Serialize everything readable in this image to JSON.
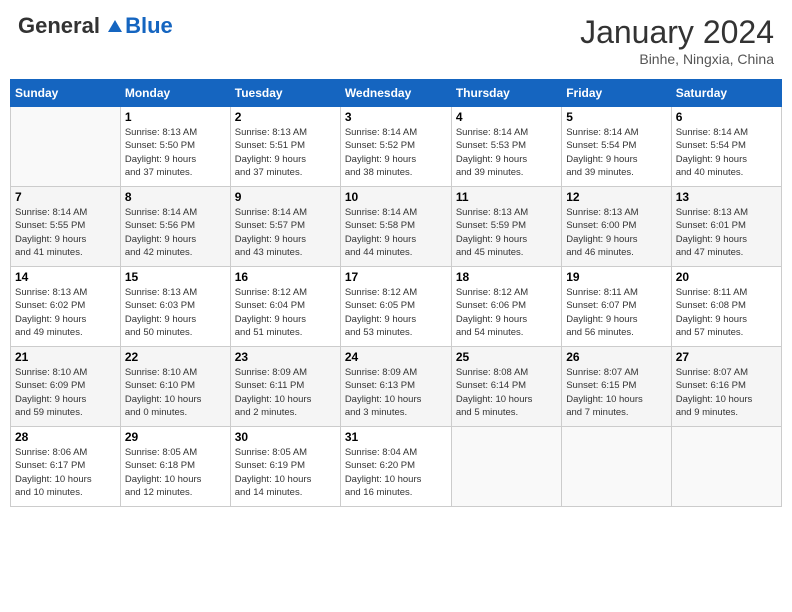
{
  "header": {
    "logo_general": "General",
    "logo_blue": "Blue",
    "month_title": "January 2024",
    "location": "Binhe, Ningxia, China"
  },
  "days_of_week": [
    "Sunday",
    "Monday",
    "Tuesday",
    "Wednesday",
    "Thursday",
    "Friday",
    "Saturday"
  ],
  "weeks": [
    [
      {
        "day": "",
        "info": ""
      },
      {
        "day": "1",
        "info": "Sunrise: 8:13 AM\nSunset: 5:50 PM\nDaylight: 9 hours\nand 37 minutes."
      },
      {
        "day": "2",
        "info": "Sunrise: 8:13 AM\nSunset: 5:51 PM\nDaylight: 9 hours\nand 37 minutes."
      },
      {
        "day": "3",
        "info": "Sunrise: 8:14 AM\nSunset: 5:52 PM\nDaylight: 9 hours\nand 38 minutes."
      },
      {
        "day": "4",
        "info": "Sunrise: 8:14 AM\nSunset: 5:53 PM\nDaylight: 9 hours\nand 39 minutes."
      },
      {
        "day": "5",
        "info": "Sunrise: 8:14 AM\nSunset: 5:54 PM\nDaylight: 9 hours\nand 39 minutes."
      },
      {
        "day": "6",
        "info": "Sunrise: 8:14 AM\nSunset: 5:54 PM\nDaylight: 9 hours\nand 40 minutes."
      }
    ],
    [
      {
        "day": "7",
        "info": "Sunrise: 8:14 AM\nSunset: 5:55 PM\nDaylight: 9 hours\nand 41 minutes."
      },
      {
        "day": "8",
        "info": "Sunrise: 8:14 AM\nSunset: 5:56 PM\nDaylight: 9 hours\nand 42 minutes."
      },
      {
        "day": "9",
        "info": "Sunrise: 8:14 AM\nSunset: 5:57 PM\nDaylight: 9 hours\nand 43 minutes."
      },
      {
        "day": "10",
        "info": "Sunrise: 8:14 AM\nSunset: 5:58 PM\nDaylight: 9 hours\nand 44 minutes."
      },
      {
        "day": "11",
        "info": "Sunrise: 8:13 AM\nSunset: 5:59 PM\nDaylight: 9 hours\nand 45 minutes."
      },
      {
        "day": "12",
        "info": "Sunrise: 8:13 AM\nSunset: 6:00 PM\nDaylight: 9 hours\nand 46 minutes."
      },
      {
        "day": "13",
        "info": "Sunrise: 8:13 AM\nSunset: 6:01 PM\nDaylight: 9 hours\nand 47 minutes."
      }
    ],
    [
      {
        "day": "14",
        "info": "Sunrise: 8:13 AM\nSunset: 6:02 PM\nDaylight: 9 hours\nand 49 minutes."
      },
      {
        "day": "15",
        "info": "Sunrise: 8:13 AM\nSunset: 6:03 PM\nDaylight: 9 hours\nand 50 minutes."
      },
      {
        "day": "16",
        "info": "Sunrise: 8:12 AM\nSunset: 6:04 PM\nDaylight: 9 hours\nand 51 minutes."
      },
      {
        "day": "17",
        "info": "Sunrise: 8:12 AM\nSunset: 6:05 PM\nDaylight: 9 hours\nand 53 minutes."
      },
      {
        "day": "18",
        "info": "Sunrise: 8:12 AM\nSunset: 6:06 PM\nDaylight: 9 hours\nand 54 minutes."
      },
      {
        "day": "19",
        "info": "Sunrise: 8:11 AM\nSunset: 6:07 PM\nDaylight: 9 hours\nand 56 minutes."
      },
      {
        "day": "20",
        "info": "Sunrise: 8:11 AM\nSunset: 6:08 PM\nDaylight: 9 hours\nand 57 minutes."
      }
    ],
    [
      {
        "day": "21",
        "info": "Sunrise: 8:10 AM\nSunset: 6:09 PM\nDaylight: 9 hours\nand 59 minutes."
      },
      {
        "day": "22",
        "info": "Sunrise: 8:10 AM\nSunset: 6:10 PM\nDaylight: 10 hours\nand 0 minutes."
      },
      {
        "day": "23",
        "info": "Sunrise: 8:09 AM\nSunset: 6:11 PM\nDaylight: 10 hours\nand 2 minutes."
      },
      {
        "day": "24",
        "info": "Sunrise: 8:09 AM\nSunset: 6:13 PM\nDaylight: 10 hours\nand 3 minutes."
      },
      {
        "day": "25",
        "info": "Sunrise: 8:08 AM\nSunset: 6:14 PM\nDaylight: 10 hours\nand 5 minutes."
      },
      {
        "day": "26",
        "info": "Sunrise: 8:07 AM\nSunset: 6:15 PM\nDaylight: 10 hours\nand 7 minutes."
      },
      {
        "day": "27",
        "info": "Sunrise: 8:07 AM\nSunset: 6:16 PM\nDaylight: 10 hours\nand 9 minutes."
      }
    ],
    [
      {
        "day": "28",
        "info": "Sunrise: 8:06 AM\nSunset: 6:17 PM\nDaylight: 10 hours\nand 10 minutes."
      },
      {
        "day": "29",
        "info": "Sunrise: 8:05 AM\nSunset: 6:18 PM\nDaylight: 10 hours\nand 12 minutes."
      },
      {
        "day": "30",
        "info": "Sunrise: 8:05 AM\nSunset: 6:19 PM\nDaylight: 10 hours\nand 14 minutes."
      },
      {
        "day": "31",
        "info": "Sunrise: 8:04 AM\nSunset: 6:20 PM\nDaylight: 10 hours\nand 16 minutes."
      },
      {
        "day": "",
        "info": ""
      },
      {
        "day": "",
        "info": ""
      },
      {
        "day": "",
        "info": ""
      }
    ]
  ]
}
